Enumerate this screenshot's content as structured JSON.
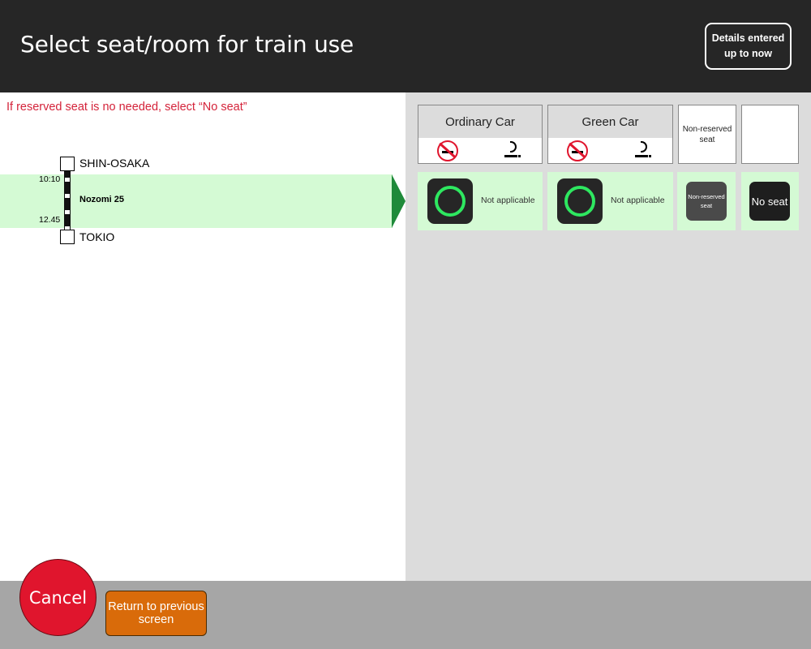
{
  "header": {
    "title": "Select seat/room for train use",
    "details_button": "Details entered up to now"
  },
  "journey": {
    "hint": "If reserved seat is no needed, select “No seat”",
    "from_station": "SHIN-OSAKA",
    "to_station": "TOKIO",
    "departure_time": "10:10",
    "arrival_time": "12.45",
    "train_name": "Nozomi 25"
  },
  "seat_options": {
    "ordinary_car": {
      "label": "Ordinary Car",
      "status": "Not applicable"
    },
    "green_car": {
      "label": "Green Car",
      "status": "Not applicable"
    },
    "non_reserved": {
      "header": "Non-reserved seat",
      "button": "Non-reserved seat"
    },
    "no_seat": {
      "button": "No seat"
    }
  },
  "footer": {
    "cancel": "Cancel",
    "return": "Return to previous screen"
  },
  "colors": {
    "header_bg": "#262626",
    "hint_text": "#d4233a",
    "train_band": "#d4fad4",
    "arrow": "#1f8a3a",
    "available_ring": "#2ee860",
    "cancel_button": "#e0152d",
    "return_button": "#d96b0a",
    "footer_bg": "#a6a6a6"
  }
}
